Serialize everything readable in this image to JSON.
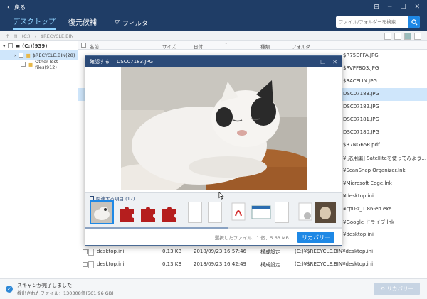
{
  "titlebar": {
    "back_label": "戻る"
  },
  "nav": {
    "tabs": [
      {
        "label": "デスクトップ",
        "active": true
      },
      {
        "label": "復元候補",
        "active": false
      }
    ],
    "filter_label": "フィルター",
    "search_placeholder": "ファイル/フォルダーを検索"
  },
  "pathbar": {
    "drive": "(C:)",
    "folder": "$RECYCLE.BIN"
  },
  "tree": {
    "root_label": "(C:)(939)",
    "items": [
      {
        "label": "$RECYCLE.BIN(28)",
        "selected": true
      },
      {
        "label": "Other lost files(912)",
        "selected": false
      }
    ]
  },
  "table": {
    "headers": {
      "name": "名前",
      "size": "サイズ",
      "date": "日付",
      "type": "種類",
      "folder": "フォルダ"
    },
    "rows": [
      {
        "folder_suffix": "$R75DFFA.JPG",
        "selected": false
      },
      {
        "folder_suffix": "$RVPF8Q3.JPG",
        "selected": false
      },
      {
        "folder_suffix": "$RACFLIN.JPG",
        "selected": false
      },
      {
        "folder_suffix": "DSC07183.JPG",
        "selected": true
      },
      {
        "folder_suffix": "DSC07182.JPG",
        "selected": false
      },
      {
        "folder_suffix": "DSC07181.JPG",
        "selected": false
      },
      {
        "folder_suffix": "DSC07180.JPG",
        "selected": false
      },
      {
        "folder_suffix": "$R7NG65R.pdf",
        "selected": false
      },
      {
        "folder_suffix": "¥[応用編] Satelliteを使ってみよう...",
        "selected": false
      },
      {
        "folder_suffix": "¥ScanSnap Organizer.lnk",
        "selected": false
      },
      {
        "folder_suffix": "¥Microsoft Edge.lnk",
        "selected": false
      },
      {
        "folder_suffix": "¥desktop.ini",
        "selected": false
      },
      {
        "folder_suffix": "¥cpu-z_1.86-en.exe",
        "selected": false
      },
      {
        "folder_suffix": "¥Google ドライブ.lnk",
        "selected": false
      },
      {
        "folder_suffix": "¥desktop.ini",
        "selected": false
      }
    ],
    "full_rows": [
      {
        "name": "desktop.ini",
        "size": "0.13 KB",
        "date": "2018/09/23 16:57:46",
        "type": "構成設定",
        "folder": "(C:)¥$RECYCLE.BIN¥desktop.ini"
      },
      {
        "name": "desktop.ini",
        "size": "0.13 KB",
        "date": "2018/09/23 16:42:49",
        "type": "構成設定",
        "folder": "(C:)¥$RECYCLE.BIN¥desktop.ini"
      }
    ]
  },
  "modal": {
    "title": "確認する",
    "filename": "DSC07183.JPG",
    "related_label": "関連する項目 (17)",
    "footer_text": "選択したファイル：1 個、5.63 MB",
    "recover_label": "リカバリー"
  },
  "status": {
    "title": "スキャンが完了しました",
    "detail": "検出されたファイル：130308個(561.96 GB)",
    "recover_label": "リカバリー"
  },
  "colors": {
    "header": "#1f3d66",
    "accent": "#1e88e5",
    "selected_row": "#cfe6fb"
  }
}
